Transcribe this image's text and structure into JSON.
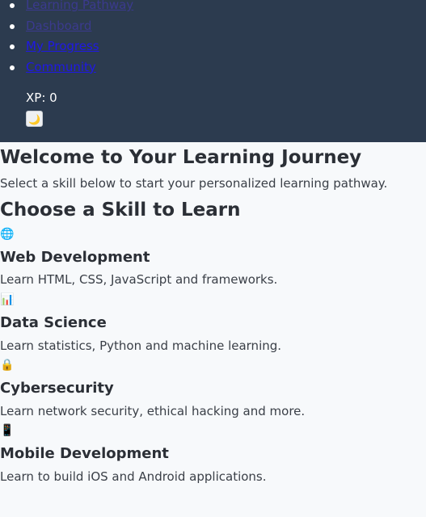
{
  "nav": {
    "items": [
      {
        "label": "Learning Pathway"
      },
      {
        "label": "Dashboard"
      },
      {
        "label": "My Progress"
      },
      {
        "label": "Community"
      }
    ],
    "xp_label": "XP: 0",
    "theme_icon": "moon-icon",
    "theme_glyph": "🌙"
  },
  "hero": {
    "title": "Welcome to Your Learning Journey",
    "subtitle": "Select a skill below to start your personalized learning pathway."
  },
  "skills": {
    "heading": "Choose a Skill to Learn",
    "items": [
      {
        "icon": "globe-icon",
        "glyph": "🌐",
        "title": "Web Development",
        "description": "Learn HTML, CSS, JavaScript and frameworks."
      },
      {
        "icon": "bar-chart-icon",
        "glyph": "📊",
        "title": "Data Science",
        "description": "Learn statistics, Python and machine learning."
      },
      {
        "icon": "lock-icon",
        "glyph": "🔒",
        "title": "Cybersecurity",
        "description": "Learn network security, ethical hacking and more."
      },
      {
        "icon": "mobile-phone-icon",
        "glyph": "📱",
        "title": "Mobile Development",
        "description": "Learn to build iOS and Android applications."
      }
    ]
  },
  "colors": {
    "header_bg": "#2c3b4f",
    "page_bg": "#f7f9fb",
    "link": "#1f18e6"
  }
}
